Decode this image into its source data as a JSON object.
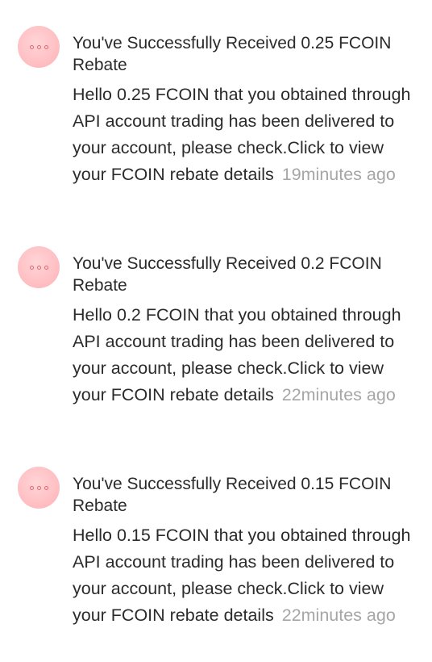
{
  "notifications": [
    {
      "icon": "more-dots-icon",
      "title": "You've Successfully Received 0.25 FCOIN Rebate",
      "body": "Hello 0.25 FCOIN that you obtained through API account trading has been delivered to your account, please check.Click to view your FCOIN rebate details",
      "time": "19minutes ago"
    },
    {
      "icon": "more-dots-icon",
      "title": "You've Successfully Received 0.2 FCOIN Rebate",
      "body": "Hello 0.2 FCOIN that you obtained through API account trading has been delivered to your account, please check.Click to view your FCOIN rebate details",
      "time": "22minutes ago"
    },
    {
      "icon": "more-dots-icon",
      "title": "You've Successfully Received 0.15 FCOIN Rebate",
      "body": "Hello 0.15 FCOIN that you obtained through API account trading has been delivered to your account, please check.Click to view your FCOIN rebate details",
      "time": "22minutes ago"
    }
  ],
  "colors": {
    "avatar_bg": "#ffbcc0",
    "avatar_dots": "#e06a72",
    "text": "#2b2b2b",
    "time": "#a6a6a6"
  }
}
